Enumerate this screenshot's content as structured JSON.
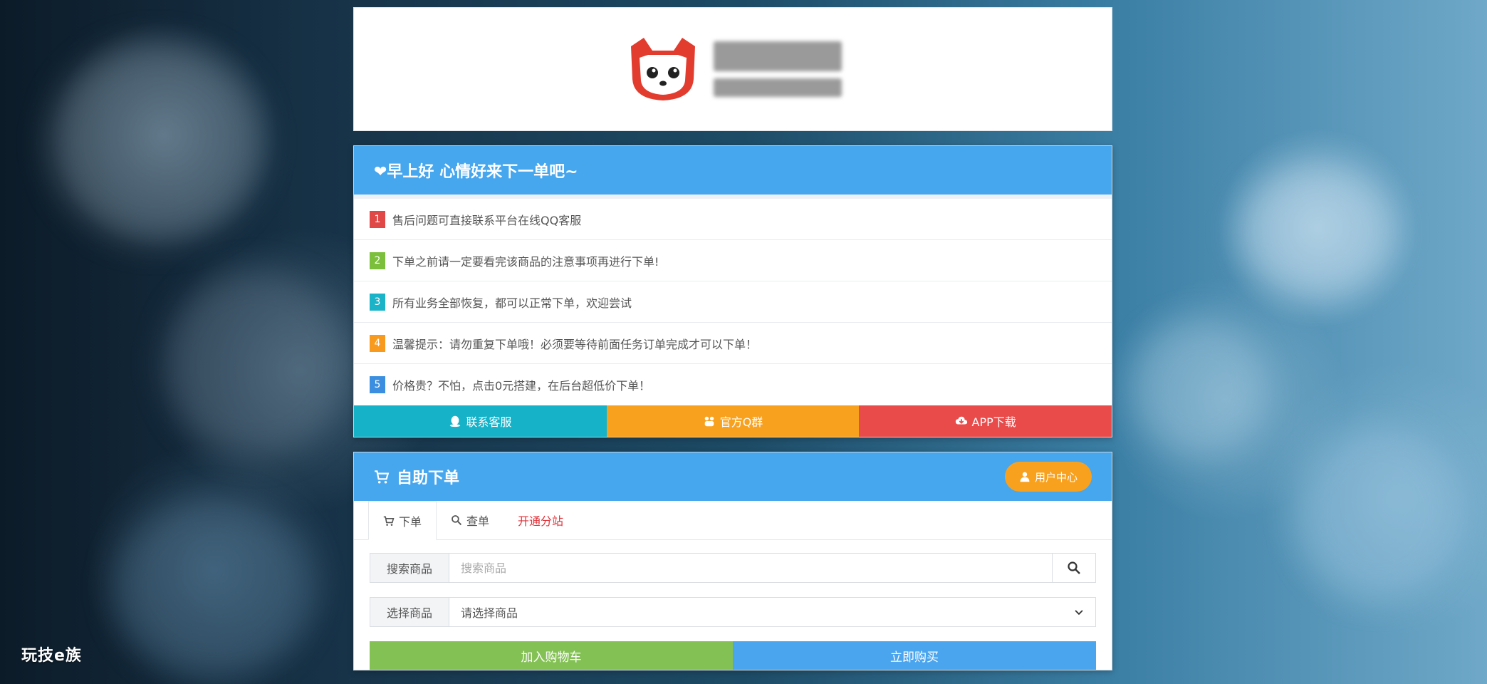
{
  "notice": {
    "title": "❤早上好 心情好来下一单吧~",
    "items": [
      {
        "num": "1",
        "color": "#e04848",
        "text": "售后问题可直接联系平台在线QQ客服"
      },
      {
        "num": "2",
        "color": "#7cbf3c",
        "text": "下单之前请一定要看完该商品的注意事项再进行下单!"
      },
      {
        "num": "3",
        "color": "#1ab3c8",
        "text": "所有业务全部恢复，都可以正常下单，欢迎尝试"
      },
      {
        "num": "4",
        "color": "#f79a1e",
        "text": "温馨提示：请勿重复下单哦！必须要等待前面任务订单完成才可以下单！"
      },
      {
        "num": "5",
        "color": "#3c8fe0",
        "text": "价格贵？不怕，点击0元搭建，在后台超低价下单！"
      }
    ],
    "buttons": [
      {
        "label": "联系客服",
        "color": "#15b2c8",
        "icon": "qq-penguin-icon"
      },
      {
        "label": "官方Q群",
        "color": "#f8a11e",
        "icon": "group-icon"
      },
      {
        "label": "APP下载",
        "color": "#e94b4b",
        "icon": "cloud-download-icon"
      }
    ]
  },
  "order": {
    "title": "自助下单",
    "user_center": "用户中心",
    "tabs": [
      {
        "label": "下单",
        "icon": "cart-icon"
      },
      {
        "label": "查单",
        "icon": "search-icon"
      },
      {
        "label": "开通分站"
      }
    ],
    "search": {
      "label": "搜索商品",
      "placeholder": "搜索商品"
    },
    "select": {
      "label": "选择商品",
      "value": "请选择商品"
    },
    "add_cart": "加入购物车",
    "buy_now": "立即购买"
  },
  "watermark": "玩技e族",
  "colors": {
    "header_blue": "#46a6ee",
    "green": "#84c155",
    "blue": "#4aa5ee",
    "orange": "#f8a11e"
  }
}
